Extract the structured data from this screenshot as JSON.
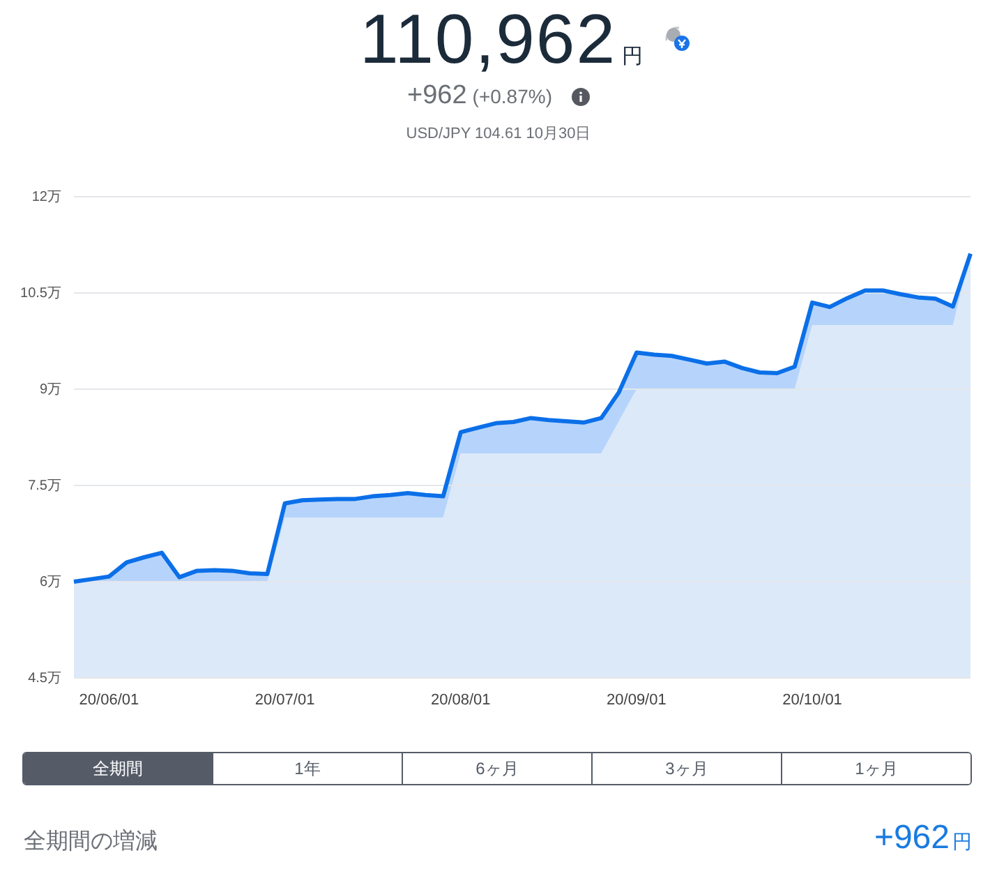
{
  "total": {
    "value": "110,962",
    "unit": "円"
  },
  "change": {
    "amount": "+962",
    "percent": "(+0.87%)"
  },
  "rate": "USD/JPY 104.61 10月30日",
  "chart": {
    "chart_data": {
      "type": "area",
      "categories": [
        null,
        null,
        "20/06/01",
        null,
        null,
        null,
        null,
        null,
        null,
        null,
        null,
        null,
        "20/07/01",
        null,
        null,
        null,
        null,
        null,
        null,
        null,
        null,
        null,
        "20/08/01",
        null,
        null,
        null,
        null,
        null,
        null,
        null,
        null,
        null,
        "20/09/01",
        null,
        null,
        null,
        null,
        null,
        null,
        null,
        null,
        null,
        "20/10/01",
        null,
        null,
        null,
        null,
        null,
        null,
        null,
        null,
        null
      ],
      "series": [
        {
          "color": "#0b6fe8",
          "values": [
            6.0,
            6.04,
            6.08,
            6.3,
            6.38,
            6.45,
            6.07,
            6.17,
            6.18,
            6.17,
            6.13,
            6.12,
            7.22,
            7.27,
            7.28,
            7.29,
            7.29,
            7.33,
            7.35,
            7.38,
            7.35,
            7.33,
            8.33,
            8.4,
            8.47,
            8.49,
            8.55,
            8.52,
            8.5,
            8.48,
            8.55,
            8.95,
            9.57,
            9.54,
            9.52,
            9.46,
            9.4,
            9.43,
            9.33,
            9.26,
            9.25,
            9.35,
            10.35,
            10.28,
            10.42,
            10.54,
            10.54,
            10.48,
            10.43,
            10.41,
            10.29,
            11.11
          ]
        },
        {
          "color": "#dce9f9",
          "values": [
            6,
            6,
            6,
            6,
            6,
            6,
            6,
            6,
            6,
            6,
            6,
            6,
            7,
            7,
            7,
            7,
            7,
            7,
            7,
            7,
            7,
            7,
            8,
            8,
            8,
            8,
            8,
            8,
            8,
            8,
            8,
            8.5,
            9,
            9,
            9,
            9,
            9,
            9,
            9,
            9,
            9,
            9,
            10,
            10,
            10,
            10,
            10,
            10,
            10,
            10,
            10,
            11.11
          ]
        }
      ],
      "ylim": [
        4.5,
        12
      ],
      "grid": true,
      "yticks": [
        {
          "value": 12,
          "label": "12万"
        },
        {
          "value": 10.5,
          "label": "10.5万"
        },
        {
          "value": 9,
          "label": "9万"
        },
        {
          "value": 7.5,
          "label": "7.5万"
        },
        {
          "value": 6,
          "label": "6万"
        },
        {
          "value": 4.5,
          "label": "4.5万"
        }
      ]
    }
  },
  "periods": [
    {
      "label": "全期間",
      "selected": true
    },
    {
      "label": "1年",
      "selected": false
    },
    {
      "label": "6ヶ月",
      "selected": false
    },
    {
      "label": "3ヶ月",
      "selected": false
    },
    {
      "label": "1ヶ月",
      "selected": false
    }
  ],
  "summary": {
    "label": "全期間の増減",
    "value": "+962",
    "unit": "円"
  }
}
